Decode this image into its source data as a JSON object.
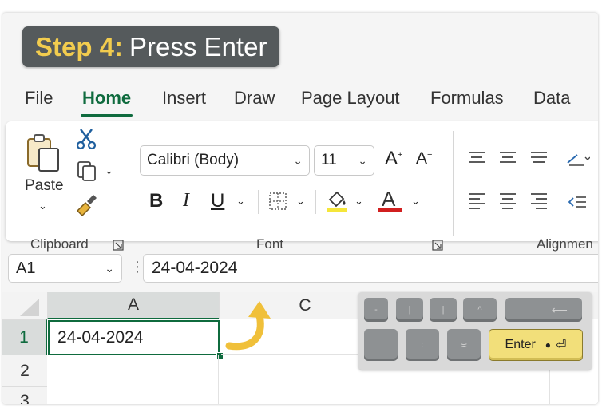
{
  "step": {
    "label": "Step 4:",
    "text": "Press Enter"
  },
  "tabs": [
    {
      "label": "File"
    },
    {
      "label": "Home",
      "active": true
    },
    {
      "label": "Insert"
    },
    {
      "label": "Draw"
    },
    {
      "label": "Page Layout"
    },
    {
      "label": "Formulas"
    },
    {
      "label": "Data"
    }
  ],
  "ribbon": {
    "clipboard": {
      "paste_label": "Paste",
      "group_label": "Clipboard"
    },
    "font": {
      "name": "Calibri (Body)",
      "size": "11",
      "bold": "B",
      "italic": "I",
      "underline": "U",
      "group_label": "Font",
      "grow_glyph": "A",
      "shrink_glyph": "A",
      "font_color_glyph": "A",
      "font_color": "#d11f1f",
      "highlight_color": "#f5e63a"
    },
    "alignment": {
      "group_label": "Alignmen"
    }
  },
  "formula_bar": {
    "name_box": "A1",
    "value": "24-04-2024"
  },
  "sheet": {
    "columns": [
      "A",
      "C"
    ],
    "rows": [
      "1",
      "2",
      "3"
    ],
    "active_cell_value": "24-04-2024"
  },
  "keyboard": {
    "enter_label": "Enter"
  },
  "colors": {
    "accent": "#0f6b3e",
    "arrow": "#f0c03a"
  }
}
